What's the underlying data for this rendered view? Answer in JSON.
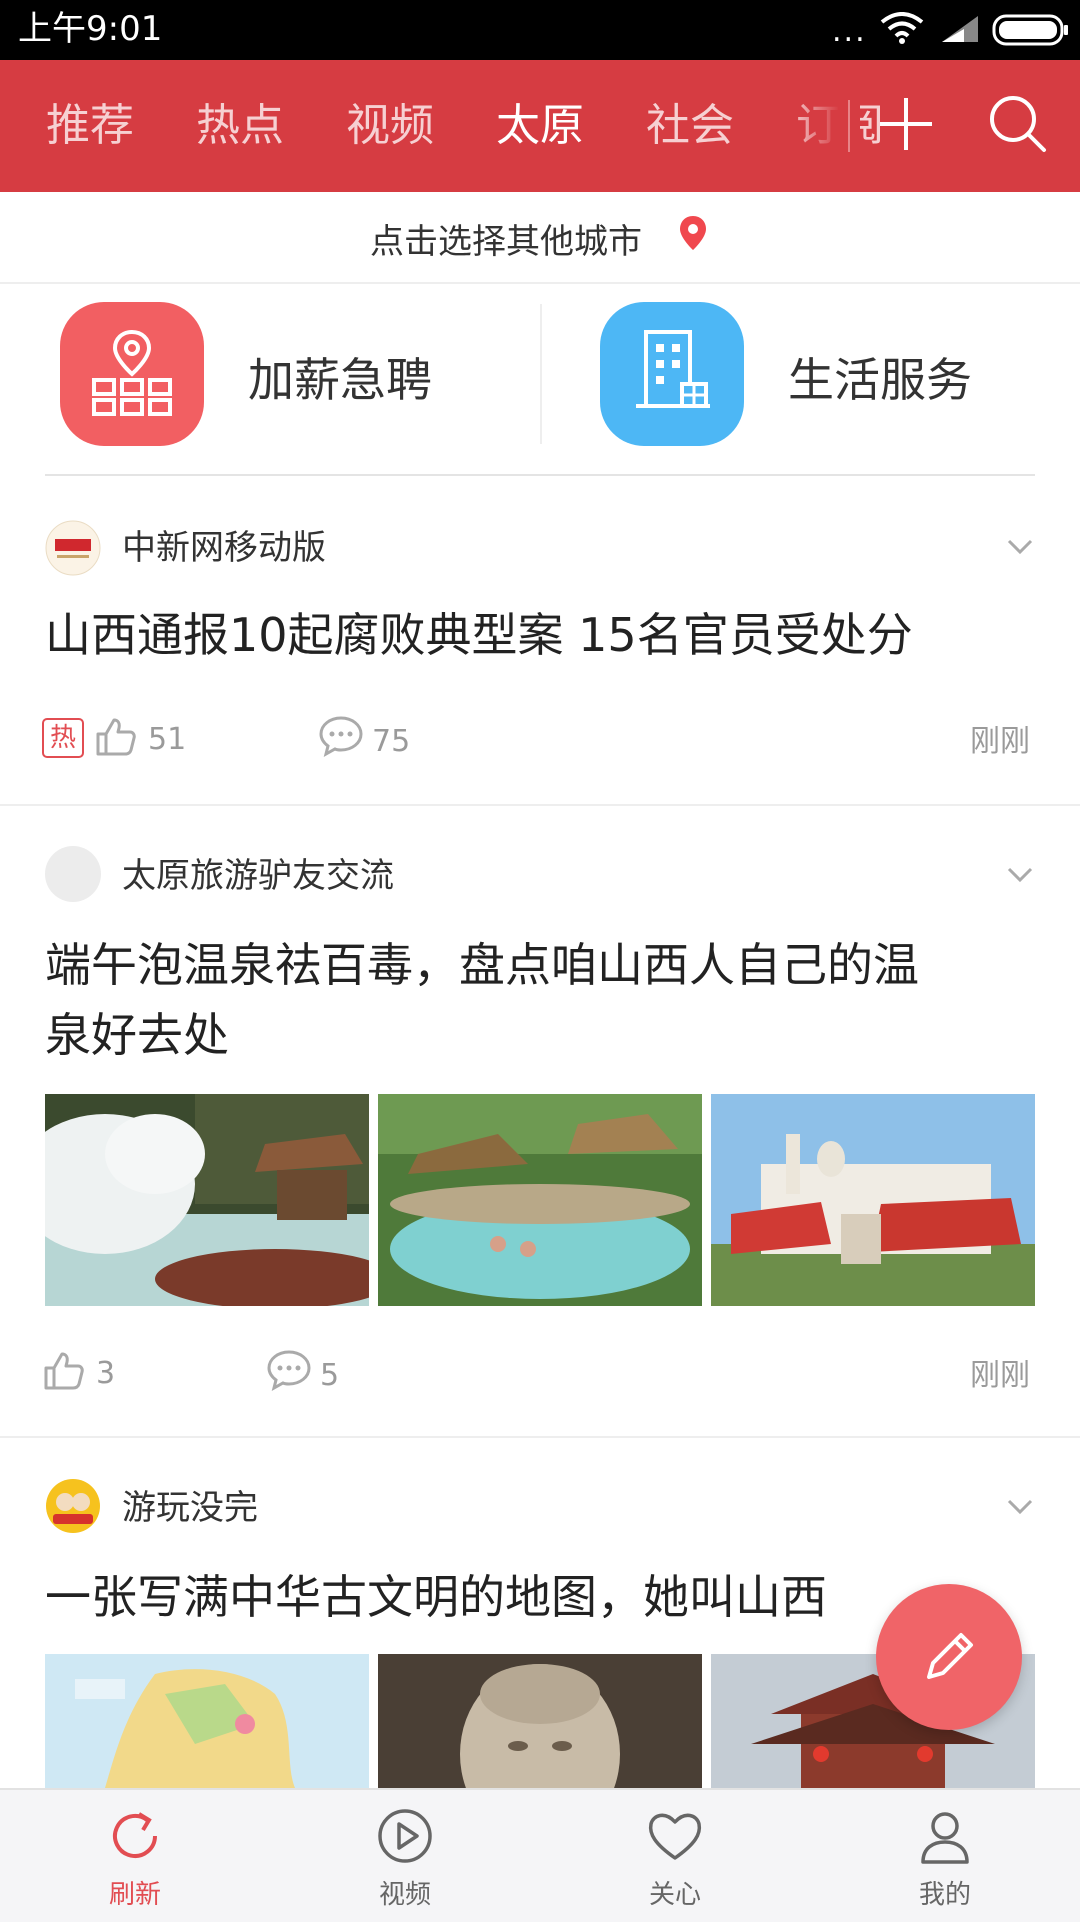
{
  "status_bar": {
    "time": "上午9:01",
    "dots": "..."
  },
  "nav": {
    "tabs": [
      {
        "label": "推荐"
      },
      {
        "label": "热点"
      },
      {
        "label": "视频"
      },
      {
        "label": "太原",
        "active": true
      },
      {
        "label": "社会"
      },
      {
        "label": "订阅"
      }
    ],
    "add_icon": "plus-icon",
    "search_icon": "search-icon"
  },
  "city_bar": {
    "label": "点击选择其他城市",
    "icon": "location-pin-icon"
  },
  "services": [
    {
      "label": "加薪急聘",
      "icon": "job-location-icon",
      "color": "#f25f62"
    },
    {
      "label": "生活服务",
      "icon": "building-icon",
      "color": "#4db7f5"
    }
  ],
  "feed": [
    {
      "source": "中新网移动版",
      "title": "山西通报10起腐败典型案 15名官员受处分",
      "hot_badge": "热",
      "likes": "51",
      "comments": "75",
      "time": "刚刚"
    },
    {
      "source": "太原旅游驴友交流",
      "title_line1": "端午泡温泉祛百毒，盘点咱山西人自己的温",
      "title_line2": "泉好去处",
      "likes": "3",
      "comments": "5",
      "time": "刚刚"
    },
    {
      "source": "游玩没完",
      "title": "一张写满中华古文明的地图，她叫山西"
    }
  ],
  "bottom_nav": [
    {
      "label": "刷新",
      "icon": "refresh-icon",
      "active": true
    },
    {
      "label": "视频",
      "icon": "play-icon"
    },
    {
      "label": "关心",
      "icon": "heart-icon"
    },
    {
      "label": "我的",
      "icon": "person-icon"
    }
  ],
  "colors": {
    "brand_red": "#d63c42",
    "accent": "#e24d52",
    "fab": "#f06468"
  }
}
